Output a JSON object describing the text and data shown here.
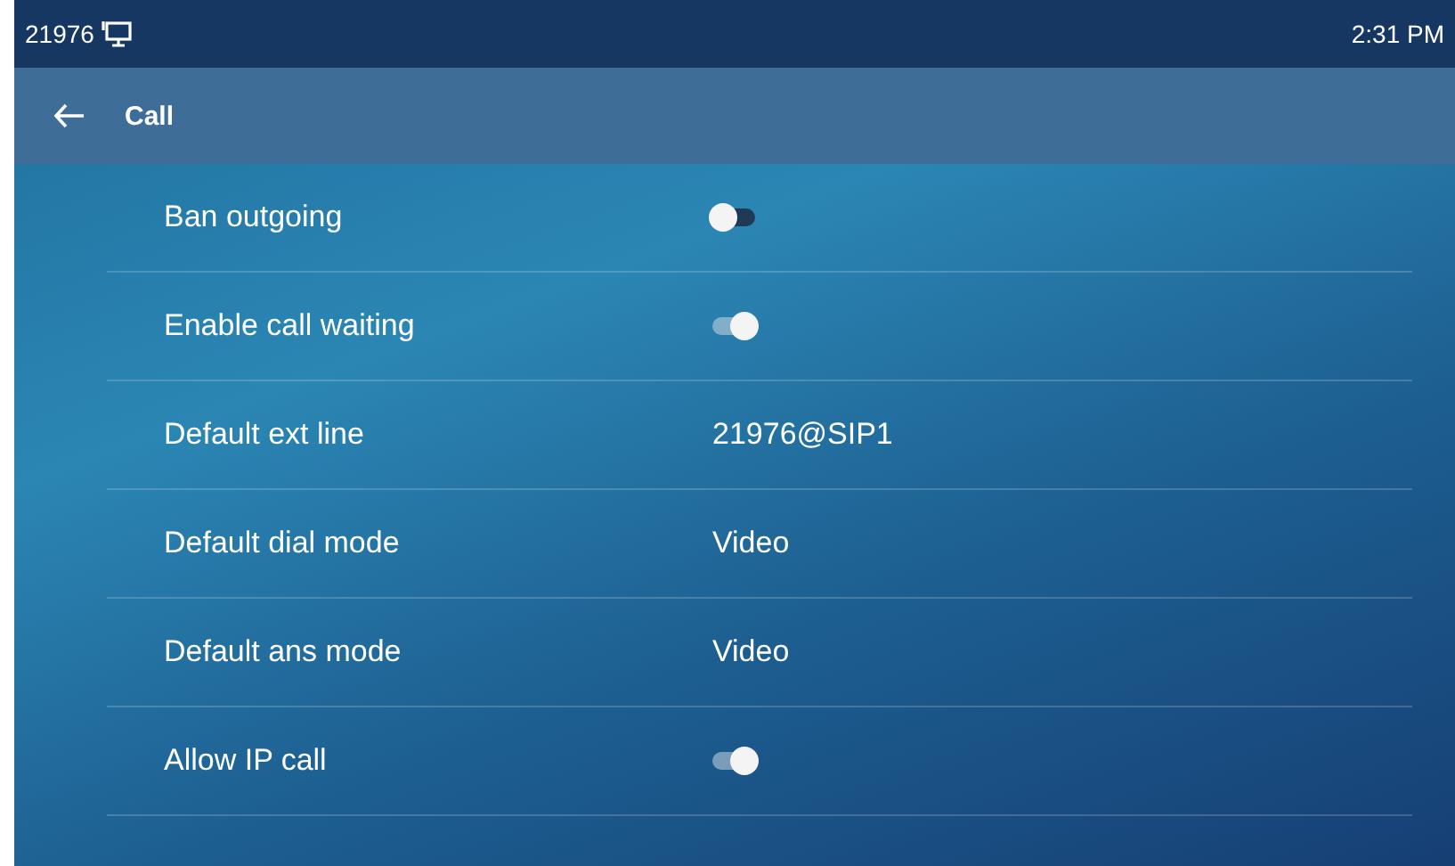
{
  "status_bar": {
    "extension": "21976",
    "time": "2:31 PM"
  },
  "title_bar": {
    "title": "Call"
  },
  "settings": [
    {
      "kind": "toggle",
      "label": "Ban outgoing",
      "on": false
    },
    {
      "kind": "toggle",
      "label": "Enable call waiting",
      "on": true
    },
    {
      "kind": "value",
      "label": "Default ext line",
      "value": "21976@SIP1"
    },
    {
      "kind": "value",
      "label": "Default dial mode",
      "value": "Video"
    },
    {
      "kind": "value",
      "label": "Default ans mode",
      "value": "Video"
    },
    {
      "kind": "toggle",
      "label": "Allow IP call",
      "on": true
    }
  ]
}
